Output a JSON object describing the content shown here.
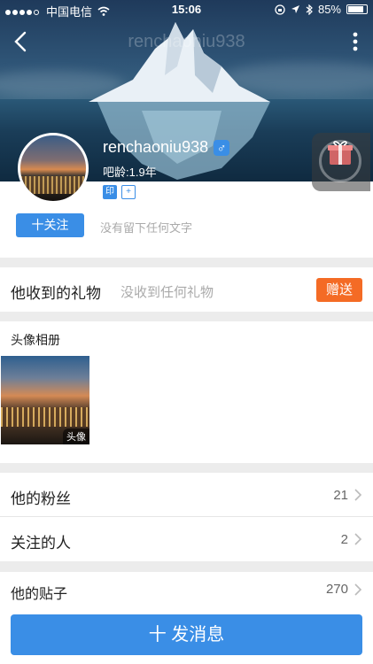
{
  "status_bar": {
    "carrier": "中国电信",
    "time": "15:06",
    "battery": "85%"
  },
  "nav": {
    "title": "renchaoniu938"
  },
  "profile": {
    "username": "renchaoniu938",
    "gender_symbol": "♂",
    "bar_age": "吧龄:1.9年",
    "badge_seal": "印",
    "badge_plus": "+",
    "follow_label": "十关注",
    "bio": "没有留下任何文字"
  },
  "gifts": {
    "title": "他收到的礼物",
    "empty_text": "没收到任何礼物",
    "give_label": "赠送"
  },
  "album": {
    "title": "头像相册",
    "thumb_tag": "头像"
  },
  "stats": [
    {
      "label": "他的粉丝",
      "count": "21"
    },
    {
      "label": "关注的人",
      "count": "2"
    }
  ],
  "posts": {
    "label": "他的贴子",
    "count": "270"
  },
  "message_button": "十 发消息",
  "colors": {
    "accent": "#3a8ee6",
    "give": "#f46b25"
  }
}
